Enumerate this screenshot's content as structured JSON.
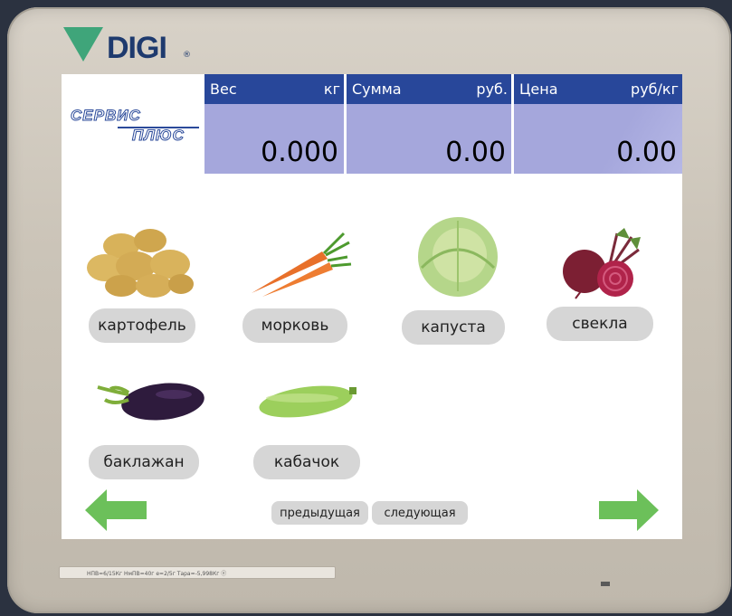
{
  "device": {
    "brand": "DIGI",
    "brand_mark": "®",
    "spec_strip": "НПВ=6/15Кг   НмПВ=40г   е=2/5г   Тара=-5,998Кг   ⓔ"
  },
  "screen": {
    "store_logo": {
      "line1": "СЕРВИС",
      "line2": "ПЛЮС"
    },
    "weight": {
      "label": "Вес",
      "unit": "кг",
      "value": "0.000"
    },
    "sum": {
      "label": "Сумма",
      "unit": "руб.",
      "value": "0.00"
    },
    "price": {
      "label": "Цена",
      "unit": "руб/кг",
      "value": "0.00"
    },
    "products": [
      {
        "label": "картофель",
        "icon": "potatoes-icon"
      },
      {
        "label": "морковь",
        "icon": "carrots-icon"
      },
      {
        "label": "капуста",
        "icon": "cabbage-icon"
      },
      {
        "label": "свекла",
        "icon": "beetroot-icon"
      },
      {
        "label": "баклажан",
        "icon": "eggplant-icon"
      },
      {
        "label": "кабачок",
        "icon": "zucchini-icon"
      }
    ],
    "nav": {
      "prev_label": "предыдущая",
      "next_label": "следующая"
    }
  },
  "colors": {
    "panel_header": "#28479a",
    "panel_value": "#a5a7dc",
    "arrow": "#6cc05a",
    "pill": "#d6d6d6"
  }
}
